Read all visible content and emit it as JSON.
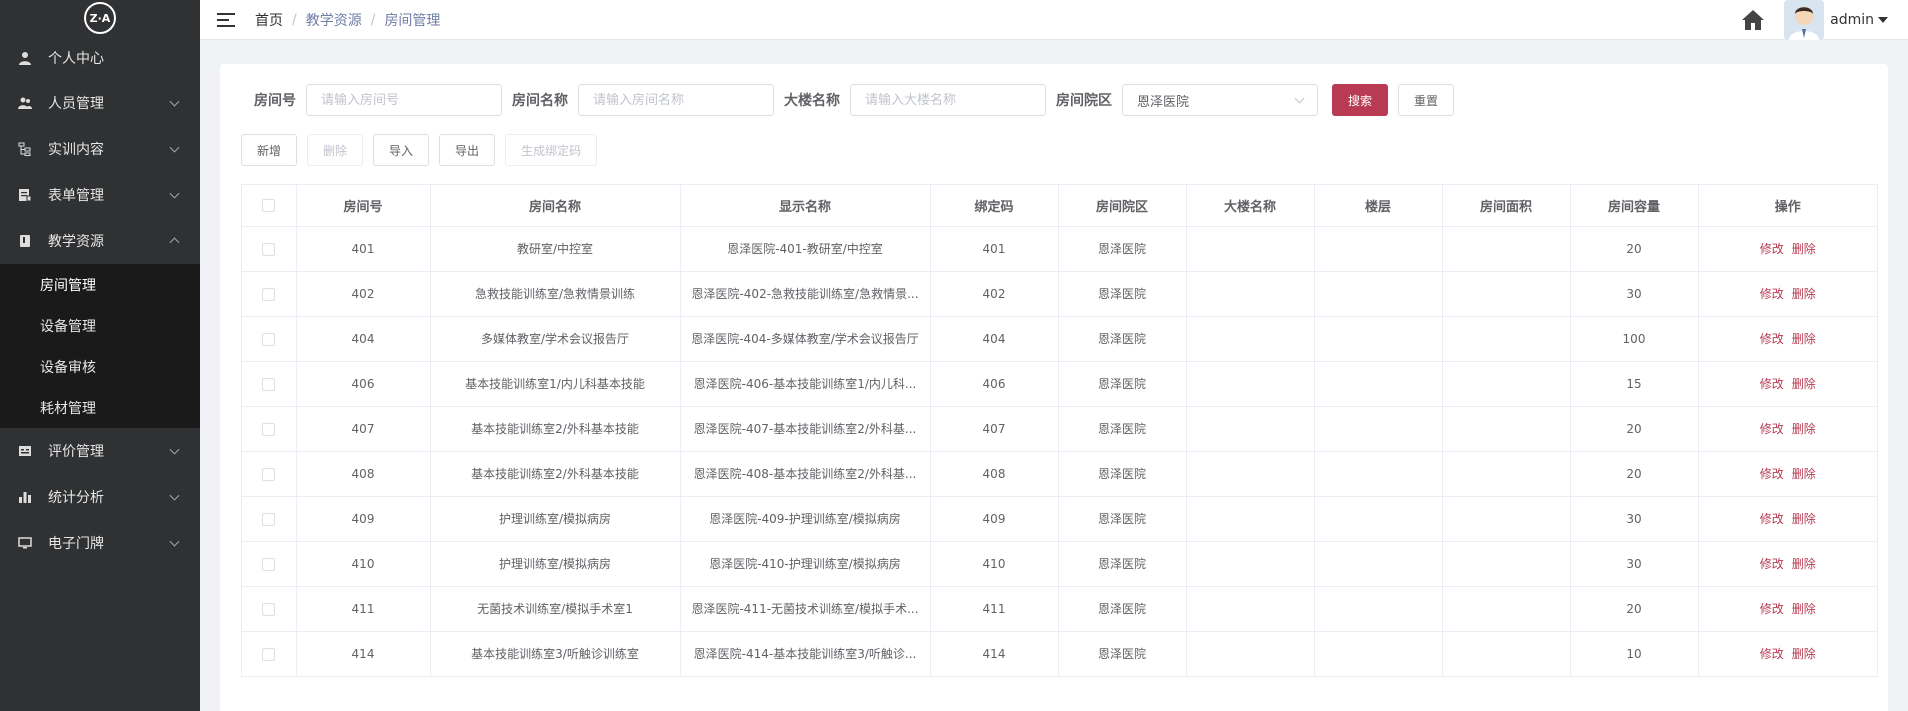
{
  "logo": {
    "text": "Z·A"
  },
  "sidebar": {
    "items": [
      {
        "label": "个人中心",
        "icon": "person-icon",
        "expandable": false
      },
      {
        "label": "人员管理",
        "icon": "people-icon",
        "expandable": true
      },
      {
        "label": "实训内容",
        "icon": "tree-icon",
        "expandable": true
      },
      {
        "label": "表单管理",
        "icon": "form-icon",
        "expandable": true
      },
      {
        "label": "教学资源",
        "icon": "book-icon",
        "expandable": true,
        "expanded": true,
        "children": [
          "房间管理",
          "设备管理",
          "设备审核",
          "耗材管理"
        ]
      },
      {
        "label": "评价管理",
        "icon": "rating-icon",
        "expandable": true
      },
      {
        "label": "统计分析",
        "icon": "bar-chart-icon",
        "expandable": true
      },
      {
        "label": "电子门牌",
        "icon": "monitor-icon",
        "expandable": true
      }
    ],
    "active_child": "房间管理"
  },
  "breadcrumb": {
    "home": "首页",
    "section": "教学资源",
    "current": "房间管理"
  },
  "user": {
    "name": "admin"
  },
  "search": {
    "room_no_label": "房间号",
    "room_no_placeholder": "请输入房间号",
    "room_name_label": "房间名称",
    "room_name_placeholder": "请输入房间名称",
    "building_label": "大楼名称",
    "building_placeholder": "请输入大楼名称",
    "campus_label": "房间院区",
    "campus_value": "恩泽医院",
    "search_button": "搜索",
    "reset_button": "重置"
  },
  "toolbar": {
    "add": "新增",
    "delete": "删除",
    "import": "导入",
    "export": "导出",
    "gen_code": "生成绑定码"
  },
  "table": {
    "headers": [
      "房间号",
      "房间名称",
      "显示名称",
      "绑定码",
      "房间院区",
      "大楼名称",
      "楼层",
      "房间面积",
      "房间容量",
      "操作"
    ],
    "edit_label": "修改",
    "delete_label": "删除",
    "rows": [
      {
        "no": "401",
        "name": "教研室/中控室",
        "display": "恩泽医院-401-教研室/中控室",
        "code": "401",
        "campus": "恩泽医院",
        "building": "",
        "floor": "",
        "area": "",
        "capacity": "20"
      },
      {
        "no": "402",
        "name": "急救技能训练室/急救情景训练",
        "display": "恩泽医院-402-急救技能训练室/急救情景...",
        "code": "402",
        "campus": "恩泽医院",
        "building": "",
        "floor": "",
        "area": "",
        "capacity": "30"
      },
      {
        "no": "404",
        "name": "多媒体教室/学术会议报告厅",
        "display": "恩泽医院-404-多媒体教室/学术会议报告厅",
        "code": "404",
        "campus": "恩泽医院",
        "building": "",
        "floor": "",
        "area": "",
        "capacity": "100"
      },
      {
        "no": "406",
        "name": "基本技能训练室1/内儿科基本技能",
        "display": "恩泽医院-406-基本技能训练室1/内儿科...",
        "code": "406",
        "campus": "恩泽医院",
        "building": "",
        "floor": "",
        "area": "",
        "capacity": "15"
      },
      {
        "no": "407",
        "name": "基本技能训练室2/外科基本技能",
        "display": "恩泽医院-407-基本技能训练室2/外科基...",
        "code": "407",
        "campus": "恩泽医院",
        "building": "",
        "floor": "",
        "area": "",
        "capacity": "20"
      },
      {
        "no": "408",
        "name": "基本技能训练室2/外科基本技能",
        "display": "恩泽医院-408-基本技能训练室2/外科基...",
        "code": "408",
        "campus": "恩泽医院",
        "building": "",
        "floor": "",
        "area": "",
        "capacity": "20"
      },
      {
        "no": "409",
        "name": "护理训练室/模拟病房",
        "display": "恩泽医院-409-护理训练室/模拟病房",
        "code": "409",
        "campus": "恩泽医院",
        "building": "",
        "floor": "",
        "area": "",
        "capacity": "30"
      },
      {
        "no": "410",
        "name": "护理训练室/模拟病房",
        "display": "恩泽医院-410-护理训练室/模拟病房",
        "code": "410",
        "campus": "恩泽医院",
        "building": "",
        "floor": "",
        "area": "",
        "capacity": "30"
      },
      {
        "no": "411",
        "name": "无菌技术训练室/模拟手术室1",
        "display": "恩泽医院-411-无菌技术训练室/模拟手术...",
        "code": "411",
        "campus": "恩泽医院",
        "building": "",
        "floor": "",
        "area": "",
        "capacity": "20"
      },
      {
        "no": "414",
        "name": "基本技能训练室3/听触诊训练室",
        "display": "恩泽医院-414-基本技能训练室3/听触诊...",
        "code": "414",
        "campus": "恩泽医院",
        "building": "",
        "floor": "",
        "area": "",
        "capacity": "10"
      }
    ]
  },
  "colors": {
    "sidebar_bg": "#303133",
    "submenu_bg": "#1a1a1a",
    "accent": "#b83b53"
  }
}
